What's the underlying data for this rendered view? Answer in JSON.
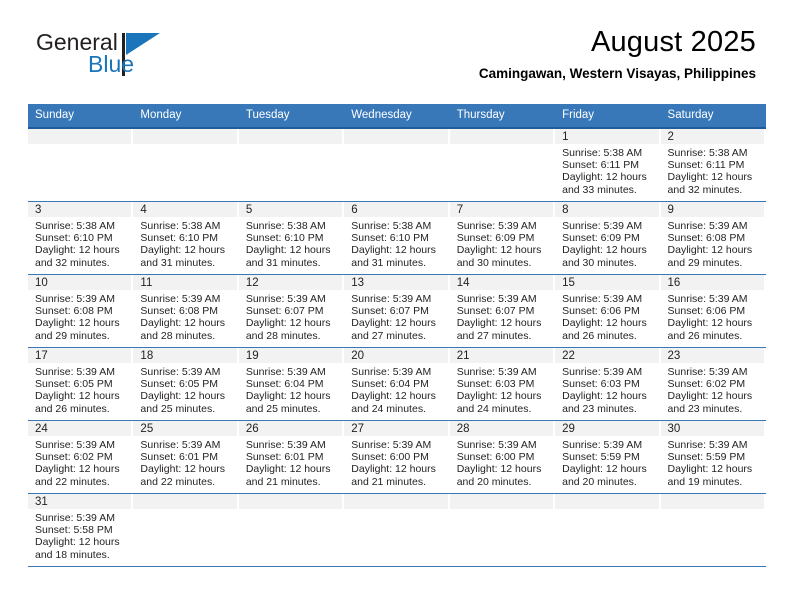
{
  "brand": {
    "name_top": "General",
    "name_bottom": "Blue",
    "accent_color": "#1b75bb",
    "logo_icon": "triangle-flag-icon"
  },
  "header": {
    "title": "August 2025",
    "subtitle": "Camingawan, Western Visayas, Philippines"
  },
  "theme": {
    "header_blue": "#3878b9",
    "header_blue_dark": "#1f5c9e",
    "daynum_strip_gray": "#f2f2f2",
    "text_dark": "#231f20"
  },
  "weekday_headers": [
    "Sunday",
    "Monday",
    "Tuesday",
    "Wednesday",
    "Thursday",
    "Friday",
    "Saturday"
  ],
  "weeks": [
    [
      {
        "day": "",
        "lines": []
      },
      {
        "day": "",
        "lines": []
      },
      {
        "day": "",
        "lines": []
      },
      {
        "day": "",
        "lines": []
      },
      {
        "day": "",
        "lines": []
      },
      {
        "day": "1",
        "lines": [
          "Sunrise: 5:38 AM",
          "Sunset: 6:11 PM",
          "Daylight: 12 hours",
          "and 33 minutes."
        ]
      },
      {
        "day": "2",
        "lines": [
          "Sunrise: 5:38 AM",
          "Sunset: 6:11 PM",
          "Daylight: 12 hours",
          "and 32 minutes."
        ]
      }
    ],
    [
      {
        "day": "3",
        "lines": [
          "Sunrise: 5:38 AM",
          "Sunset: 6:10 PM",
          "Daylight: 12 hours",
          "and 32 minutes."
        ]
      },
      {
        "day": "4",
        "lines": [
          "Sunrise: 5:38 AM",
          "Sunset: 6:10 PM",
          "Daylight: 12 hours",
          "and 31 minutes."
        ]
      },
      {
        "day": "5",
        "lines": [
          "Sunrise: 5:38 AM",
          "Sunset: 6:10 PM",
          "Daylight: 12 hours",
          "and 31 minutes."
        ]
      },
      {
        "day": "6",
        "lines": [
          "Sunrise: 5:38 AM",
          "Sunset: 6:10 PM",
          "Daylight: 12 hours",
          "and 31 minutes."
        ]
      },
      {
        "day": "7",
        "lines": [
          "Sunrise: 5:39 AM",
          "Sunset: 6:09 PM",
          "Daylight: 12 hours",
          "and 30 minutes."
        ]
      },
      {
        "day": "8",
        "lines": [
          "Sunrise: 5:39 AM",
          "Sunset: 6:09 PM",
          "Daylight: 12 hours",
          "and 30 minutes."
        ]
      },
      {
        "day": "9",
        "lines": [
          "Sunrise: 5:39 AM",
          "Sunset: 6:08 PM",
          "Daylight: 12 hours",
          "and 29 minutes."
        ]
      }
    ],
    [
      {
        "day": "10",
        "lines": [
          "Sunrise: 5:39 AM",
          "Sunset: 6:08 PM",
          "Daylight: 12 hours",
          "and 29 minutes."
        ]
      },
      {
        "day": "11",
        "lines": [
          "Sunrise: 5:39 AM",
          "Sunset: 6:08 PM",
          "Daylight: 12 hours",
          "and 28 minutes."
        ]
      },
      {
        "day": "12",
        "lines": [
          "Sunrise: 5:39 AM",
          "Sunset: 6:07 PM",
          "Daylight: 12 hours",
          "and 28 minutes."
        ]
      },
      {
        "day": "13",
        "lines": [
          "Sunrise: 5:39 AM",
          "Sunset: 6:07 PM",
          "Daylight: 12 hours",
          "and 27 minutes."
        ]
      },
      {
        "day": "14",
        "lines": [
          "Sunrise: 5:39 AM",
          "Sunset: 6:07 PM",
          "Daylight: 12 hours",
          "and 27 minutes."
        ]
      },
      {
        "day": "15",
        "lines": [
          "Sunrise: 5:39 AM",
          "Sunset: 6:06 PM",
          "Daylight: 12 hours",
          "and 26 minutes."
        ]
      },
      {
        "day": "16",
        "lines": [
          "Sunrise: 5:39 AM",
          "Sunset: 6:06 PM",
          "Daylight: 12 hours",
          "and 26 minutes."
        ]
      }
    ],
    [
      {
        "day": "17",
        "lines": [
          "Sunrise: 5:39 AM",
          "Sunset: 6:05 PM",
          "Daylight: 12 hours",
          "and 26 minutes."
        ]
      },
      {
        "day": "18",
        "lines": [
          "Sunrise: 5:39 AM",
          "Sunset: 6:05 PM",
          "Daylight: 12 hours",
          "and 25 minutes."
        ]
      },
      {
        "day": "19",
        "lines": [
          "Sunrise: 5:39 AM",
          "Sunset: 6:04 PM",
          "Daylight: 12 hours",
          "and 25 minutes."
        ]
      },
      {
        "day": "20",
        "lines": [
          "Sunrise: 5:39 AM",
          "Sunset: 6:04 PM",
          "Daylight: 12 hours",
          "and 24 minutes."
        ]
      },
      {
        "day": "21",
        "lines": [
          "Sunrise: 5:39 AM",
          "Sunset: 6:03 PM",
          "Daylight: 12 hours",
          "and 24 minutes."
        ]
      },
      {
        "day": "22",
        "lines": [
          "Sunrise: 5:39 AM",
          "Sunset: 6:03 PM",
          "Daylight: 12 hours",
          "and 23 minutes."
        ]
      },
      {
        "day": "23",
        "lines": [
          "Sunrise: 5:39 AM",
          "Sunset: 6:02 PM",
          "Daylight: 12 hours",
          "and 23 minutes."
        ]
      }
    ],
    [
      {
        "day": "24",
        "lines": [
          "Sunrise: 5:39 AM",
          "Sunset: 6:02 PM",
          "Daylight: 12 hours",
          "and 22 minutes."
        ]
      },
      {
        "day": "25",
        "lines": [
          "Sunrise: 5:39 AM",
          "Sunset: 6:01 PM",
          "Daylight: 12 hours",
          "and 22 minutes."
        ]
      },
      {
        "day": "26",
        "lines": [
          "Sunrise: 5:39 AM",
          "Sunset: 6:01 PM",
          "Daylight: 12 hours",
          "and 21 minutes."
        ]
      },
      {
        "day": "27",
        "lines": [
          "Sunrise: 5:39 AM",
          "Sunset: 6:00 PM",
          "Daylight: 12 hours",
          "and 21 minutes."
        ]
      },
      {
        "day": "28",
        "lines": [
          "Sunrise: 5:39 AM",
          "Sunset: 6:00 PM",
          "Daylight: 12 hours",
          "and 20 minutes."
        ]
      },
      {
        "day": "29",
        "lines": [
          "Sunrise: 5:39 AM",
          "Sunset: 5:59 PM",
          "Daylight: 12 hours",
          "and 20 minutes."
        ]
      },
      {
        "day": "30",
        "lines": [
          "Sunrise: 5:39 AM",
          "Sunset: 5:59 PM",
          "Daylight: 12 hours",
          "and 19 minutes."
        ]
      }
    ],
    [
      {
        "day": "31",
        "lines": [
          "Sunrise: 5:39 AM",
          "Sunset: 5:58 PM",
          "Daylight: 12 hours",
          "and 18 minutes."
        ]
      },
      {
        "day": "",
        "lines": []
      },
      {
        "day": "",
        "lines": []
      },
      {
        "day": "",
        "lines": []
      },
      {
        "day": "",
        "lines": []
      },
      {
        "day": "",
        "lines": []
      },
      {
        "day": "",
        "lines": []
      }
    ]
  ]
}
